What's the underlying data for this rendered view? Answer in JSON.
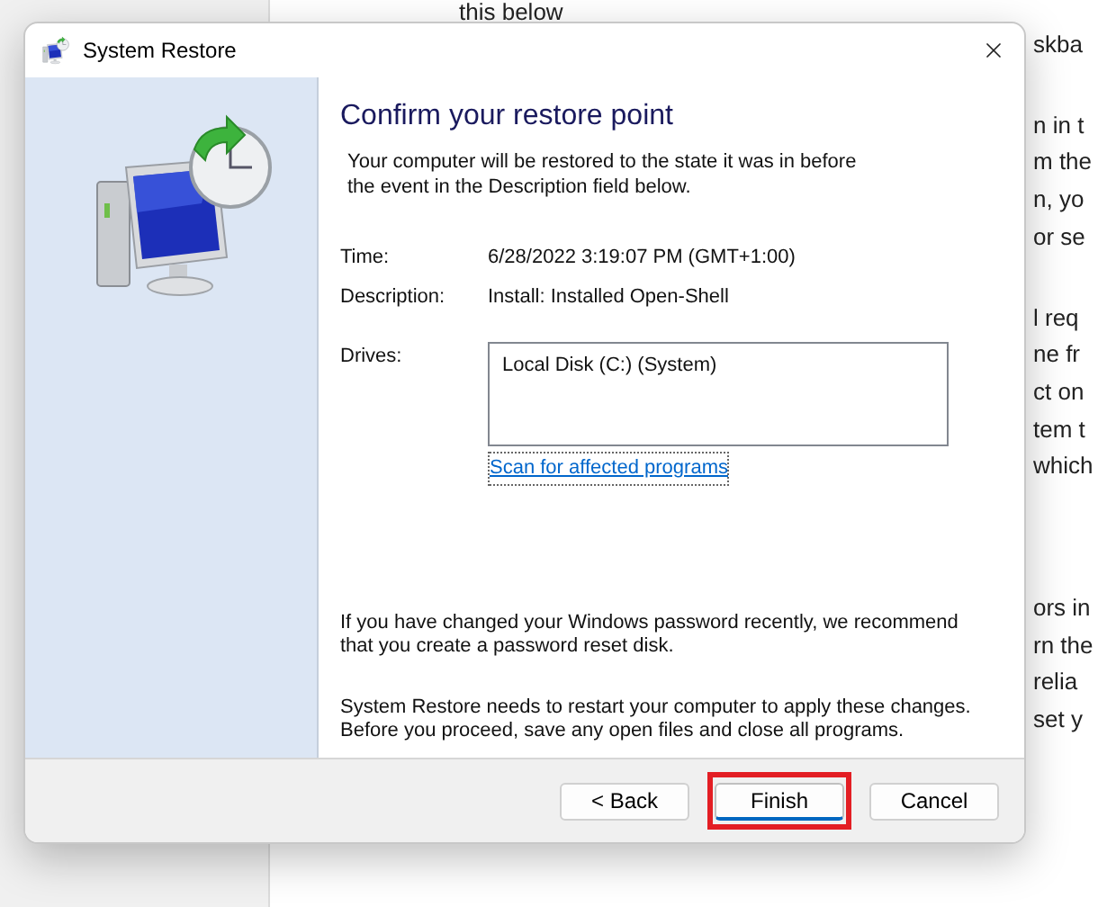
{
  "background_page": {
    "top_line": "this below",
    "fragments": [
      [
        "skba"
      ],
      [
        "n in t",
        "m the",
        "n, yo",
        "or se"
      ],
      [
        "l req",
        "ne fr",
        "ct on",
        "tem t",
        "which"
      ],
      [
        "ors in",
        "rn the",
        "relia",
        "set y"
      ]
    ]
  },
  "window": {
    "title": "System Restore"
  },
  "heading": "Confirm your restore point",
  "intro": "Your computer will be restored to the state it was in before the event in the Description field below.",
  "fields": [
    {
      "label": "Time:",
      "value": "6/28/2022 3:19:07 PM (GMT+1:00)"
    },
    {
      "label": "Description:",
      "value": "Install: Installed Open-Shell"
    }
  ],
  "drives": {
    "label": "Drives:",
    "items": [
      "Local Disk (C:) (System)"
    ],
    "link": "Scan for affected programs"
  },
  "notes": [
    "If you have changed your Windows password recently, we recommend that you create a password reset disk.",
    "System Restore needs to restart your computer to apply these changes. Before you proceed, save any open files and close all programs."
  ],
  "buttons": [
    {
      "label": "< Back",
      "default": false,
      "highlighted": false
    },
    {
      "label": "Finish",
      "default": true,
      "highlighted": true
    },
    {
      "label": "Cancel",
      "default": false,
      "highlighted": false
    }
  ]
}
